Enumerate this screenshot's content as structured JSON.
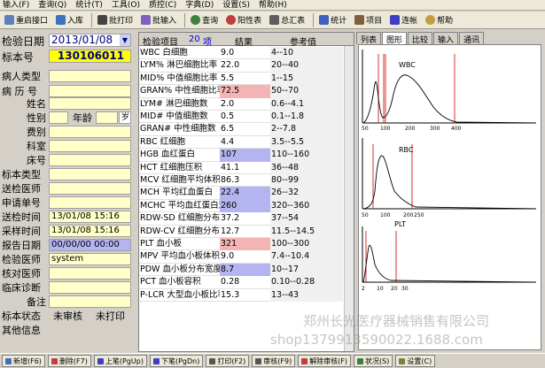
{
  "menu": [
    "输入(F)",
    "查询(Q)",
    "统计(T)",
    "工具(O)",
    "质控(C)",
    "字典(D)",
    "设置(S)",
    "帮助(H)"
  ],
  "toolbar": [
    {
      "label": "重启接口",
      "color": "#5f7fbf"
    },
    {
      "label": "入库",
      "color": "#3f6fbf"
    },
    {
      "label": "批打印",
      "color": "#444"
    },
    {
      "label": "批输入",
      "color": "#7f5fbf"
    },
    {
      "label": "查询",
      "color": "#3f7f3f"
    },
    {
      "label": "阳性表",
      "color": "#bf3f3f"
    },
    {
      "label": "总汇表",
      "color": "#5f5f5f"
    },
    {
      "label": "统计",
      "color": "#3f5fbf"
    },
    {
      "label": "项目",
      "color": "#7f5f3f"
    },
    {
      "label": "连帐",
      "color": "#3f3fbf"
    },
    {
      "label": "帮助",
      "color": "#bf9f3f"
    }
  ],
  "form": {
    "date_label": "检验日期",
    "date_value": "2013/01/08",
    "specimen_label": "标本号",
    "specimen_value": "130106011",
    "patient_type": "病人类型",
    "case_no": "病 历 号",
    "name": "姓名",
    "sex": "性别",
    "age": "年龄",
    "age_unit": "岁",
    "fee": "费别",
    "dept": "科室",
    "bed": "床号",
    "specimen_type": "标本类型",
    "send_doctor": "送检医师",
    "apply_no": "申请单号",
    "send_time": "送检时间",
    "send_time_val": "13/01/08 15:16",
    "collect_time": "采样时间",
    "collect_time_val": "13/01/08 15:16",
    "report_date": "报告日期",
    "report_date_val": "00/00/00 00:00",
    "check_doctor": "检验医师",
    "check_doctor_val": "system",
    "verify_doctor": "核对医师",
    "diagnosis": "临床诊断",
    "remark": "备注",
    "status_label": "标本状态",
    "status1": "未审核",
    "status2": "未打印",
    "other": "其他信息"
  },
  "table": {
    "col_item": "检验项目",
    "count": "20",
    "col_item2": "项",
    "col_result": "结果",
    "col_ref": "参考值",
    "rows": [
      {
        "name": "WBC 白细胞",
        "result": "9.0",
        "ref": "4--10",
        "hl": ""
      },
      {
        "name": "LYM% 淋巴细胞比率",
        "result": "22.0",
        "ref": "20--40",
        "hl": ""
      },
      {
        "name": "MID% 中值细胞比率",
        "result": "5.5",
        "ref": "1--15",
        "hl": ""
      },
      {
        "name": "GRAN% 中性细胞比率",
        "result": "72.5",
        "ref": "50--70",
        "hl": "#f4b4b4"
      },
      {
        "name": "LYM# 淋巴细胞数",
        "result": "2.0",
        "ref": "0.6--4.1",
        "hl": ""
      },
      {
        "name": "MID# 中值细胞数",
        "result": "0.5",
        "ref": "0.1--1.8",
        "hl": ""
      },
      {
        "name": "GRAN# 中性细胞数",
        "result": "6.5",
        "ref": "2--7.8",
        "hl": ""
      },
      {
        "name": "RBC 红细胞",
        "result": "4.4",
        "ref": "3.5--5.5",
        "hl": ""
      },
      {
        "name": "HGB 血红蛋白",
        "result": "107",
        "ref": "110--160",
        "hl": "#b4b4f0"
      },
      {
        "name": "HCT 红细胞压积",
        "result": "41.1",
        "ref": "36--48",
        "hl": ""
      },
      {
        "name": "MCV 红细胞平均体积",
        "result": "86.3",
        "ref": "80--99",
        "hl": ""
      },
      {
        "name": "MCH 平均红血蛋白",
        "result": "22.4",
        "ref": "26--32",
        "hl": "#b4b4f0"
      },
      {
        "name": "MCHC 平均血红蛋白浓度",
        "result": "260",
        "ref": "320--360",
        "hl": "#b4b4f0"
      },
      {
        "name": "RDW-SD 红细胞分布宽度",
        "result": "37.2",
        "ref": "37--54",
        "hl": ""
      },
      {
        "name": "RDW-CV 红细胞分布宽度",
        "result": "12.7",
        "ref": "11.5--14.5",
        "hl": ""
      },
      {
        "name": "PLT 血小板",
        "result": "321",
        "ref": "100--300",
        "hl": "#f4b4b4"
      },
      {
        "name": "MPV 平均血小板体积",
        "result": "9.0",
        "ref": "7.4--10.4",
        "hl": ""
      },
      {
        "name": "PDW 血小板分布宽度",
        "result": "8.7",
        "ref": "10--17",
        "hl": "#b4b4f0"
      },
      {
        "name": "PCT 血小板容积",
        "result": "0.28",
        "ref": "0.10--0.28",
        "hl": ""
      },
      {
        "name": "P-LCR 大型血小板比率",
        "result": "15.3",
        "ref": "13--43",
        "hl": ""
      }
    ]
  },
  "tabs": [
    "列表",
    "图形",
    "比较",
    "输入",
    "通讯"
  ],
  "graphs": {
    "wbc": {
      "label": "WBC",
      "ticks": [
        "50",
        "100",
        "200",
        "300",
        "400"
      ]
    },
    "rbc": {
      "label": "RBC",
      "ticks": [
        "50",
        "100",
        "200",
        "250"
      ]
    },
    "plt": {
      "label": "PLT",
      "ticks": [
        "2",
        "10",
        "20",
        "30"
      ]
    }
  },
  "bottom_buttons": [
    {
      "label": "新增(F6)",
      "color": "#3f6fbf"
    },
    {
      "label": "删除(F7)",
      "color": "#bf3f3f"
    },
    {
      "label": "上笔(PgUp)",
      "color": "#3f3fbf"
    },
    {
      "label": "下笔(PgDn)",
      "color": "#3f3fbf"
    },
    {
      "label": "打印(F2)",
      "color": "#555"
    },
    {
      "label": "审核(F9)",
      "color": "#555"
    },
    {
      "label": "解除审核(F)",
      "color": "#bf3f3f"
    },
    {
      "label": "状况(S)",
      "color": "#3f7f3f"
    },
    {
      "label": "设置(C)",
      "color": "#7f7f3f"
    }
  ],
  "watermark1": "郑州长光医疗器械销售有限公司",
  "watermark2": "shop1379913590022.1688.com"
}
